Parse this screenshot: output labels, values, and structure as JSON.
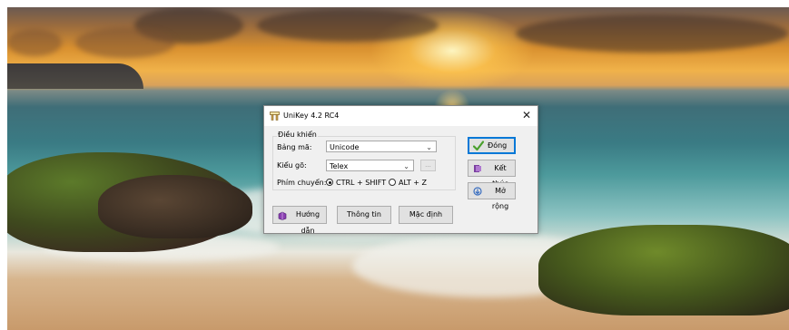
{
  "window": {
    "title": "UniKey 4.2 RC4",
    "close_glyph": "✕"
  },
  "controls": {
    "group_label": "Điều khiển",
    "charset_label": "Bảng mã:",
    "charset_value": "Unicode",
    "input_method_label": "Kiểu gõ:",
    "input_method_value": "Telex",
    "more_glyph": "...",
    "switch_label": "Phím chuyển:",
    "switch_options": [
      {
        "label": "CTRL + SHIFT",
        "selected": true
      },
      {
        "label": "ALT + Z",
        "selected": false
      }
    ]
  },
  "buttons": {
    "close": {
      "label": "Đóng",
      "icon": "checkmark-icon"
    },
    "exit": {
      "label": "Kết thúc",
      "icon": "exit-icon"
    },
    "expand": {
      "label": "Mở rộng",
      "icon": "expand-icon"
    },
    "help": {
      "label": "Hướng dẫn",
      "icon": "book-icon"
    },
    "info": {
      "label": "Thông tin"
    },
    "default": {
      "label": "Mặc định"
    }
  },
  "colors": {
    "accent": "#0078d7",
    "check_green": "#4aa02c"
  }
}
